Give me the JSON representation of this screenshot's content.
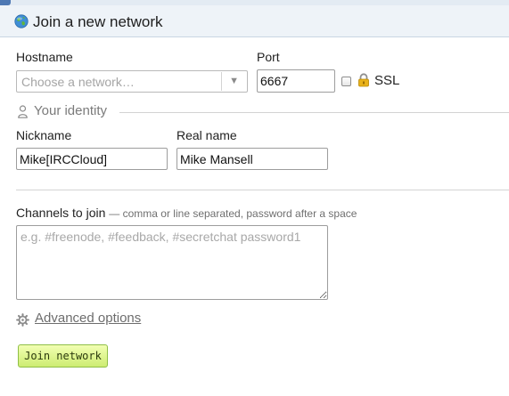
{
  "dialog": {
    "title": "Join a new network"
  },
  "connection": {
    "hostname_label": "Hostname",
    "hostname_placeholder": "Choose a network…",
    "port_label": "Port",
    "port_value": "6667",
    "ssl_label": "SSL",
    "ssl_checked": false
  },
  "identity": {
    "section_title": "Your identity",
    "nickname_label": "Nickname",
    "nickname_value": "Mike[IRCCloud]",
    "realname_label": "Real name",
    "realname_value": "Mike Mansell"
  },
  "channels": {
    "label": "Channels to join",
    "hint": "— comma or line separated, password after a space",
    "placeholder": "e.g. #freenode, #feedback, #secretchat password1"
  },
  "advanced": {
    "label": "Advanced options"
  },
  "actions": {
    "join_label": "Join network"
  },
  "colors": {
    "button_top": "#f2ffb2",
    "button_bottom": "#cdec72",
    "titlebar_bg": "#eef3f8"
  }
}
